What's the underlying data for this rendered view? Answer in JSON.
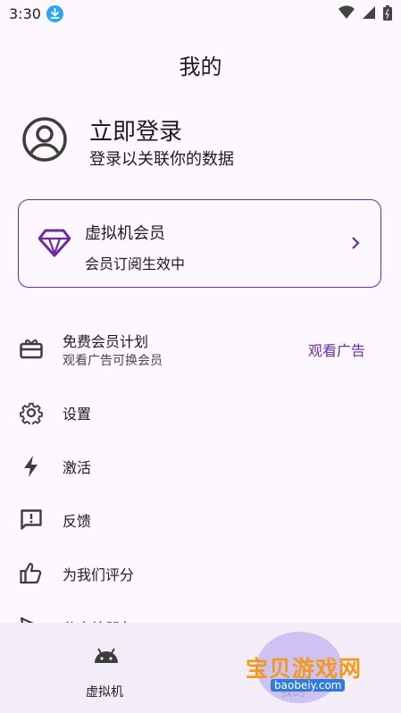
{
  "status_bar": {
    "time": "3:30"
  },
  "header": {
    "title": "我的"
  },
  "login": {
    "title": "立即登录",
    "subtitle": "登录以关联你的数据"
  },
  "vip_card": {
    "title": "虚拟机会员",
    "subtitle": "会员订阅生效中"
  },
  "free_plan": {
    "title": "免费会员计划",
    "subtitle": "观看广告可换会员",
    "action_label": "观看广告"
  },
  "menu": {
    "items": [
      {
        "label": "设置",
        "icon": "gear-icon"
      },
      {
        "label": "激活",
        "icon": "bolt-icon"
      },
      {
        "label": "反馈",
        "icon": "feedback-icon"
      },
      {
        "label": "为我们评分",
        "icon": "thumbs-up-icon"
      },
      {
        "label": "分享给朋友",
        "icon": "send-icon"
      }
    ]
  },
  "bottom_nav": {
    "items": [
      {
        "label": "虚拟机",
        "icon": "android-icon"
      },
      {
        "label": "我的",
        "icon": "person-icon"
      }
    ]
  },
  "watermark": {
    "text": "宝贝游戏网",
    "url": "baobeiy.com"
  },
  "colors": {
    "accent": "#6d2aa0",
    "background": "#fdf8fe",
    "nav_background": "#f3edf7"
  }
}
